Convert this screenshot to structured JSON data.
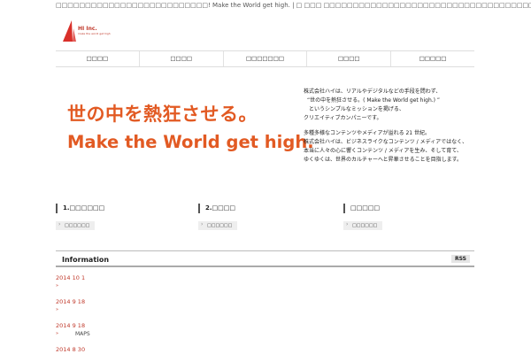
{
  "header": {
    "tagline": "□□□□□□□□□□□□□□□□□□□□□□□□□□! Make the World get high. | □ □□□ □□□□□□□□□□□□□□□□□□□□□□□□□□□□□□□□□□□□□□□□",
    "logo_text": "HI Inc.",
    "logo_sub": "make the world get high"
  },
  "nav": {
    "items": [
      "□□□□",
      "□□□□",
      "□□□□□□□",
      "□□□□",
      "□□□□□"
    ]
  },
  "hero": {
    "line1": "世の中を熱狂させる。",
    "line2": "Make the World get high."
  },
  "intro": {
    "p1": [
      "株式会社ハイは、リアルやデジタルなどの手段を問わず、",
      "“世の中を熱狂させる。( Make the World get high.) ”",
      "というシンプルなミッションを掲げる、",
      "クリエイティブカンパニーです。"
    ],
    "p2": [
      "多種多様なコンテンツやメディアが溢れる 21 世紀。",
      "株式会社ハイは、ビジネスライクなコンテンツ / メディアではなく、",
      "本当に人々の心に響くコンテンツ / メディアを生み、そして育て、",
      "ゆくゆくは、世界のカルチャーへと昇華させることを目指します。"
    ]
  },
  "columns": [
    {
      "title": "1.□□□□□□",
      "button": "□□□□□□"
    },
    {
      "title": "2.□□□□",
      "button": "□□□□□□"
    },
    {
      "title": "□□□□□",
      "button": "□□□□□□"
    }
  ],
  "information": {
    "title": "Information",
    "rss_label": "RSS",
    "entries": [
      {
        "date": "2014 10 1",
        "bullet": "»",
        "text": ""
      },
      {
        "date": "2014 9 18",
        "bullet": "»",
        "text": ""
      },
      {
        "date": "2014 9 18",
        "bullet": "»",
        "text": "MAPS"
      },
      {
        "date": "2014 8 30",
        "bullet": "",
        "text": ""
      }
    ]
  },
  "colors": {
    "accent": "#e25a23",
    "date_red": "#c0392b"
  }
}
